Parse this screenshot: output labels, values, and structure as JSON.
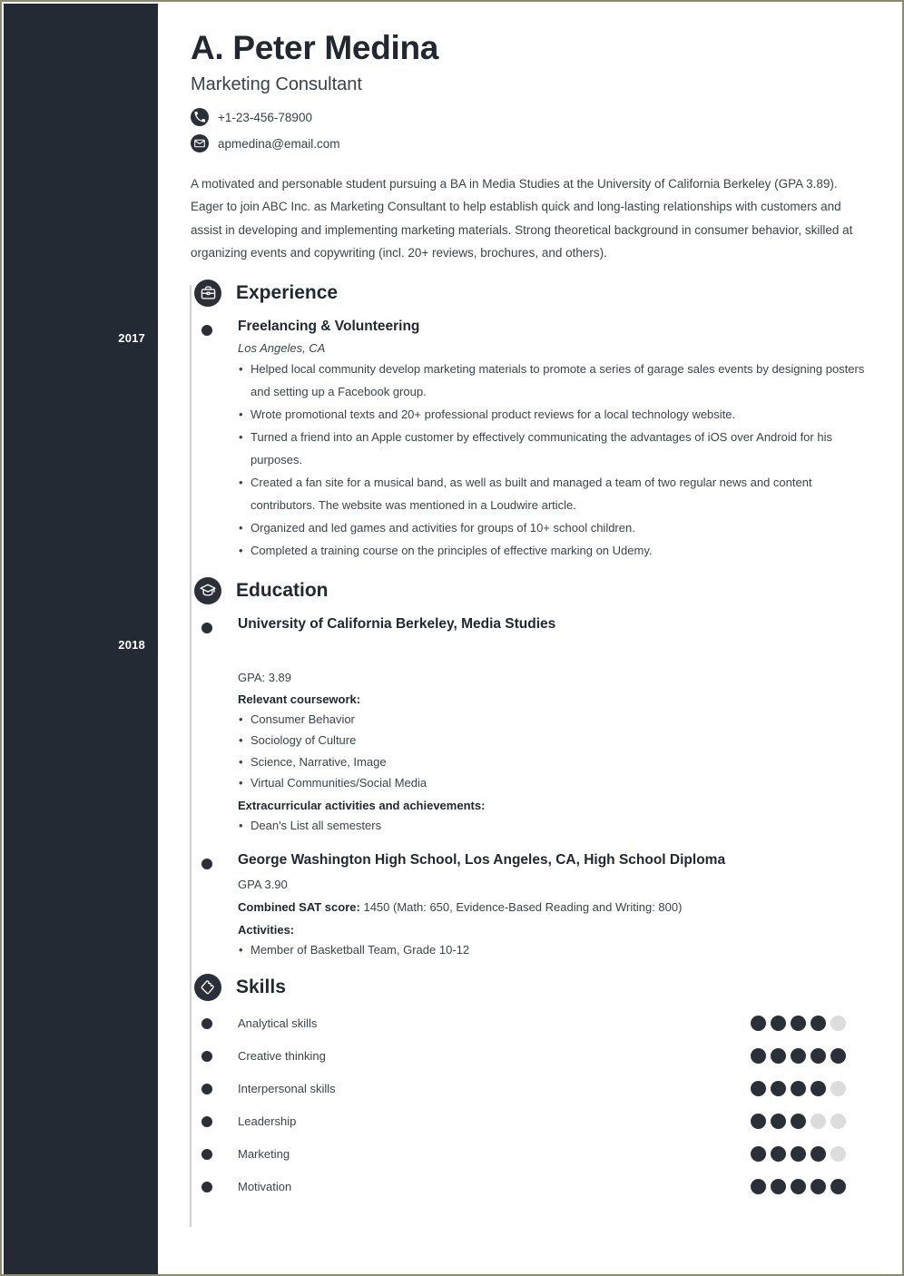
{
  "theme": {
    "sidebar_color": "#242a33",
    "accent_color": "#2b3038",
    "rail_color": "#d3d3d3",
    "rating_on": "#2b3038",
    "rating_off": "#dcdcdc",
    "page_border": "#8a8a6e"
  },
  "header": {
    "name": "A. Peter Medina",
    "job_title": "Marketing Consultant",
    "contacts": [
      {
        "icon": "phone-icon",
        "value": "+1-23-456-78900"
      },
      {
        "icon": "envelope-icon",
        "value": "apmedina@email.com"
      }
    ]
  },
  "summary": "A motivated and personable student pursuing a BA in Media Studies at the University of California Berkeley (GPA 3.89). Eager to join ABC Inc. as Marketing Consultant to help establish quick and long-lasting relationships with customers and assist in developing and implementing marketing materials. Strong theoretical background in consumer behavior, skilled at organizing events and copywriting (incl. 20+ reviews, brochures, and others).",
  "experience": {
    "title": "Experience",
    "icon": "briefcase-icon",
    "year": "2017",
    "entry": {
      "title": "Freelancing & Volunteering",
      "location": "Los Angeles, CA",
      "bullets": [
        "Helped local community develop marketing materials to promote a series of garage sales events by designing posters and setting up a Facebook group.",
        "Wrote promotional texts and 20+ professional product reviews for a local technology website.",
        "Turned a friend into an Apple customer by effectively communicating the advantages of iOS over Android for his purposes.",
        "Created a fan site for a musical band, as well as built and managed a team of two regular news and content contributors. The website was mentioned in a Loudwire article.",
        "Organized and led games and activities for groups of 10+ school children.",
        "Completed a training course on the principles of effective marking on Udemy."
      ]
    }
  },
  "education": {
    "title": "Education",
    "icon": "graduation-cap-icon",
    "year": "2018",
    "university": {
      "title": "University of California Berkeley, Media Studies",
      "gpa": "GPA: 3.89",
      "coursework_label": "Relevant coursework:",
      "coursework": [
        "Consumer Behavior",
        "Sociology of Culture",
        "Science, Narrative, Image",
        "Virtual Communities/Social Media"
      ],
      "extracurricular_label": "Extracurricular activities and achievements:",
      "extracurricular": [
        "Dean's List all semesters"
      ]
    },
    "highschool": {
      "title": "George Washington High School, Los Angeles, CA, High School Diploma",
      "gpa": "GPA 3.90",
      "sat_label": "Combined SAT score:",
      "sat_value": "1450 (Math: 650, Evidence-Based Reading and Writing: 800)",
      "activities_label": "Activities:",
      "activities": [
        "Member of Basketball Team, Grade 10-12"
      ]
    }
  },
  "skills": {
    "title": "Skills",
    "icon": "puzzle-piece-icon",
    "max_rating": 5,
    "items": [
      {
        "name": "Analytical skills",
        "rating": 4
      },
      {
        "name": "Creative thinking",
        "rating": 5
      },
      {
        "name": "Interpersonal skills",
        "rating": 4
      },
      {
        "name": "Leadership",
        "rating": 3
      },
      {
        "name": "Marketing",
        "rating": 4
      },
      {
        "name": "Motivation",
        "rating": 5
      }
    ]
  }
}
